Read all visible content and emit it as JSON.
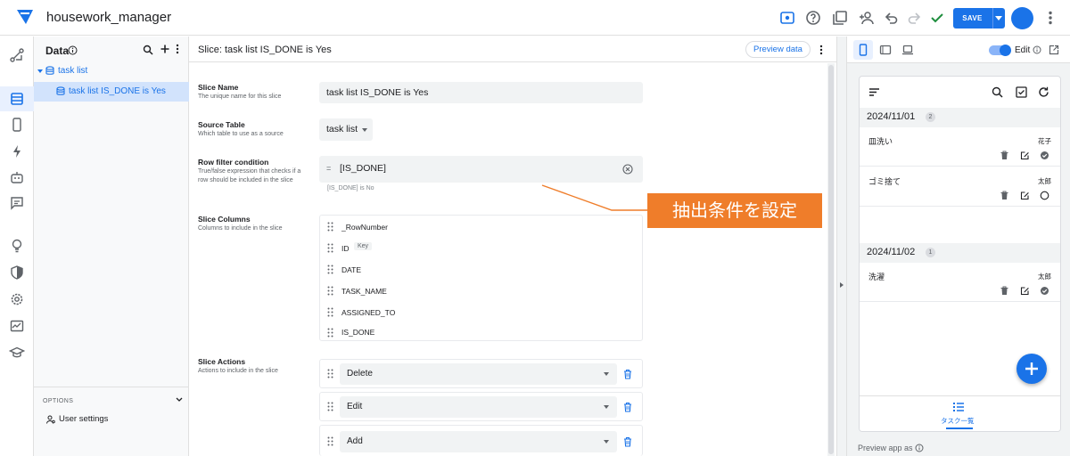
{
  "app": {
    "title": "housework_manager"
  },
  "topbar": {
    "save_label": "SAVE"
  },
  "data_panel": {
    "title": "Data",
    "table_name": "task list",
    "slice_name": "task list IS_DONE is Yes",
    "options_label": "OPTIONS",
    "user_settings_label": "User settings"
  },
  "main": {
    "header_title": "Slice: task list IS_DONE is Yes",
    "preview_data_label": "Preview data",
    "slice_name": {
      "label": "Slice Name",
      "help": "The unique name for this slice",
      "value": "task list IS_DONE is Yes"
    },
    "source_table": {
      "label": "Source Table",
      "help": "Which table to use as a source",
      "value": "task list"
    },
    "row_filter": {
      "label": "Row filter condition",
      "help": "True/false expression that checks if a row should be included in the slice",
      "prefix": "=",
      "value": "[IS_DONE]",
      "hint": "[IS_DONE] is No"
    },
    "slice_columns": {
      "label": "Slice Columns",
      "help": "Columns to include in the slice",
      "columns": [
        {
          "name": "_RowNumber",
          "tag": ""
        },
        {
          "name": "ID",
          "tag": "Key"
        },
        {
          "name": "DATE",
          "tag": ""
        },
        {
          "name": "TASK_NAME",
          "tag": ""
        },
        {
          "name": "ASSIGNED_TO",
          "tag": ""
        },
        {
          "name": "IS_DONE",
          "tag": ""
        }
      ]
    },
    "slice_actions": {
      "label": "Slice Actions",
      "help": "Actions to include in the slice",
      "actions": [
        "Delete",
        "Edit",
        "Add"
      ]
    }
  },
  "preview": {
    "edit_label": "Edit",
    "preview_as_label": "Preview app as",
    "groups": [
      {
        "date": "2024/11/01",
        "count": "2",
        "items": [
          {
            "name": "皿洗い",
            "assignee": "花子",
            "done": true
          },
          {
            "name": "ゴミ捨て",
            "assignee": "太郎",
            "done": false
          }
        ]
      },
      {
        "date": "2024/11/02",
        "count": "1",
        "items": [
          {
            "name": "洗濯",
            "assignee": "太郎",
            "done": true
          }
        ]
      }
    ],
    "nav_label": "タスク一覧"
  },
  "callout": {
    "text": "抽出条件を設定"
  },
  "colors": {
    "accent": "#1a73e8",
    "callout": "#ef7d2a",
    "selected": "#d2e3fc"
  }
}
